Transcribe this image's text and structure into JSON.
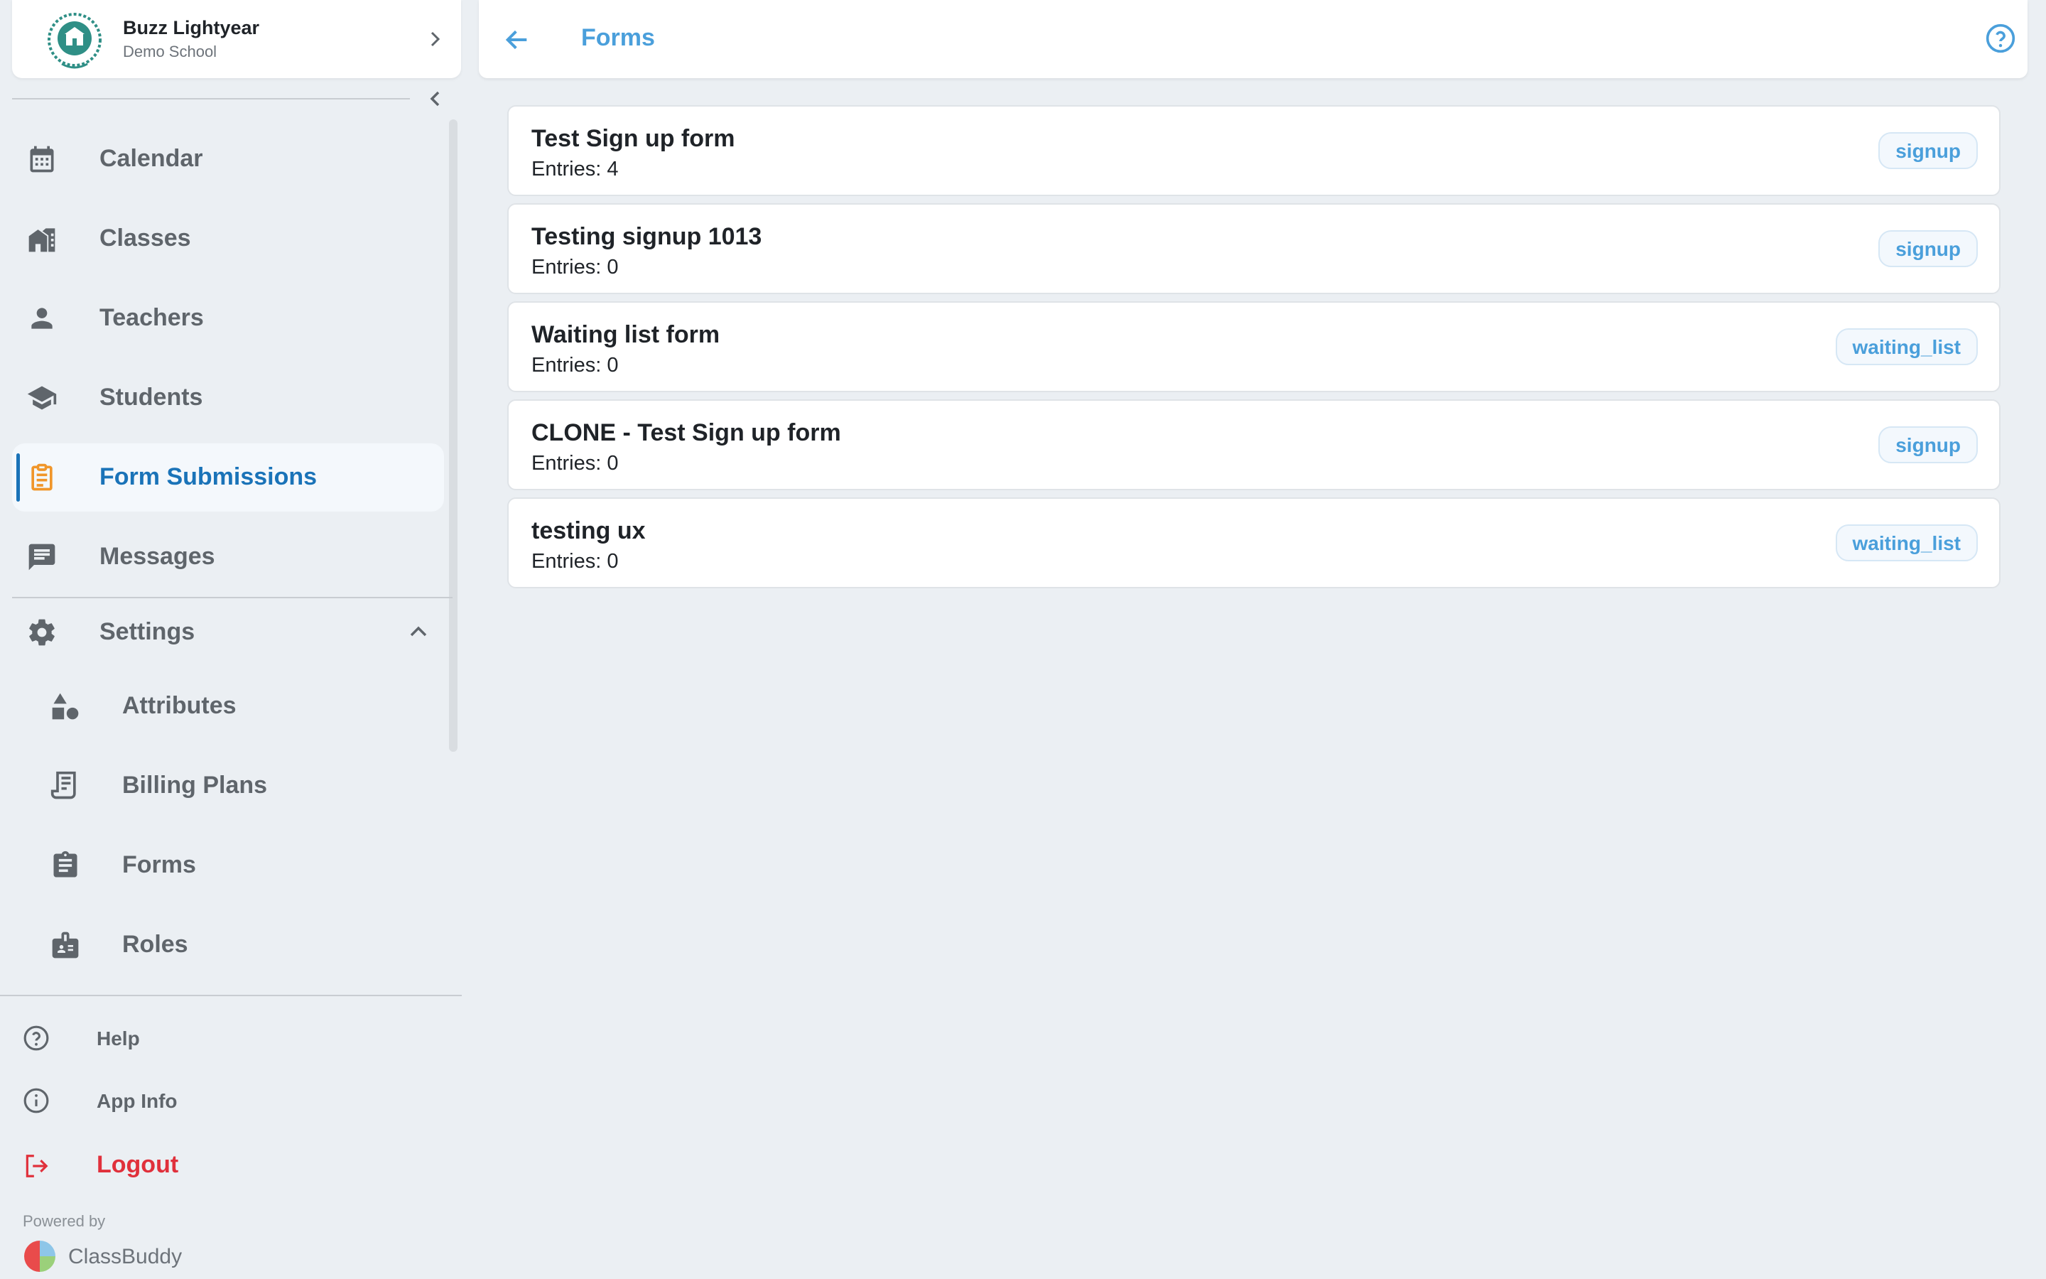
{
  "profile": {
    "name": "Buzz Lightyear",
    "school": "Demo School"
  },
  "sidebar": {
    "items": [
      {
        "label": "Calendar",
        "icon": "calendar-icon"
      },
      {
        "label": "Classes",
        "icon": "classes-icon"
      },
      {
        "label": "Teachers",
        "icon": "person-icon"
      },
      {
        "label": "Students",
        "icon": "graduation-cap-icon"
      },
      {
        "label": "Form Submissions",
        "icon": "clipboard-icon",
        "active": true
      },
      {
        "label": "Messages",
        "icon": "message-icon"
      }
    ],
    "settings": {
      "label": "Settings",
      "icon": "gear-icon",
      "expanded": true,
      "items": [
        {
          "label": "Attributes",
          "icon": "shapes-icon"
        },
        {
          "label": "Billing Plans",
          "icon": "receipt-icon"
        },
        {
          "label": "Forms",
          "icon": "clipboard-list-icon"
        },
        {
          "label": "Roles",
          "icon": "badge-icon"
        }
      ]
    },
    "utility": [
      {
        "label": "Help",
        "icon": "help-circle-icon"
      },
      {
        "label": "App Info",
        "icon": "info-circle-icon"
      },
      {
        "label": "Logout",
        "icon": "logout-icon"
      }
    ],
    "powered_by": "Powered by",
    "brand": "ClassBuddy"
  },
  "header": {
    "title": "Forms"
  },
  "forms": [
    {
      "title": "Test Sign up form",
      "entries_label": "Entries:",
      "entries": "4",
      "tag": "signup"
    },
    {
      "title": "Testing signup 1013",
      "entries_label": "Entries:",
      "entries": "0",
      "tag": "signup"
    },
    {
      "title": "Waiting list form",
      "entries_label": "Entries:",
      "entries": "0",
      "tag": "waiting_list"
    },
    {
      "title": "CLONE - Test Sign up form",
      "entries_label": "Entries:",
      "entries": "0",
      "tag": "signup"
    },
    {
      "title": "testing ux",
      "entries_label": "Entries:",
      "entries": "0",
      "tag": "waiting_list"
    }
  ],
  "colors": {
    "accent": "#4a9fdb",
    "active_nav": "#1a73b8",
    "active_icon": "#f0962a",
    "logout": "#e0303b",
    "background": "#ebeff3"
  }
}
